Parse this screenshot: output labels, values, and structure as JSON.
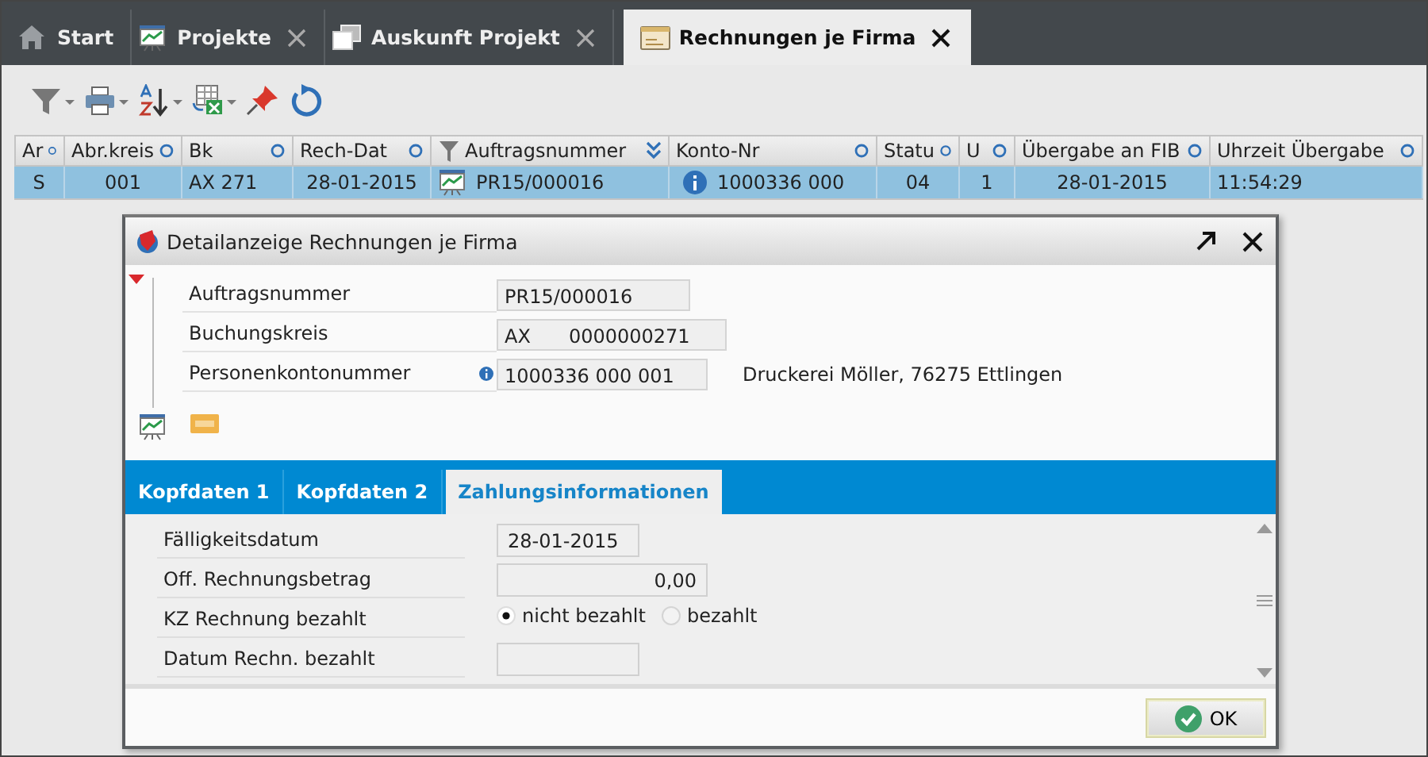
{
  "tabs": [
    {
      "label": "Start",
      "closable": false,
      "selected": false
    },
    {
      "label": "Projekte",
      "closable": true,
      "selected": false
    },
    {
      "label": "Auskunft Projekt",
      "closable": true,
      "selected": false
    },
    {
      "label": "Rechnungen je Firma",
      "closable": true,
      "selected": true
    }
  ],
  "table": {
    "columns": [
      {
        "label": "Ar",
        "filtered": false
      },
      {
        "label": "Abr.kreis",
        "filtered": false
      },
      {
        "label": "Bk",
        "filtered": false
      },
      {
        "label": "Rech-Dat",
        "filtered": false
      },
      {
        "label": "Auftragsnummer",
        "filtered": true
      },
      {
        "label": "Konto-Nr",
        "filtered": false
      },
      {
        "label": "Statu",
        "filtered": false
      },
      {
        "label": "U",
        "filtered": false
      },
      {
        "label": "Übergabe an FIB",
        "filtered": false
      },
      {
        "label": "Uhrzeit Übergabe",
        "filtered": false
      }
    ],
    "rows": [
      {
        "selected": true,
        "cells": [
          "S",
          "001",
          "AX 271",
          "28-01-2015",
          "PR15/000016",
          "1000336 000",
          "04",
          "1",
          "28-01-2015",
          "11:54:29"
        ]
      }
    ]
  },
  "dialog": {
    "title": "Detailanzeige Rechnungen je Firma",
    "fields": [
      {
        "label": "Auftragsnummer",
        "info": false,
        "values": [
          "PR15/000016"
        ]
      },
      {
        "label": "Buchungskreis",
        "info": false,
        "values": [
          "AX",
          "0000000271"
        ]
      },
      {
        "label": "Personenkontonummer",
        "info": true,
        "values": [
          "1000336 000 001"
        ],
        "note": "Druckerei Möller, 76275 Ettlingen"
      }
    ],
    "subtabs": [
      {
        "label": "Kopfdaten 1",
        "selected": false
      },
      {
        "label": "Kopfdaten 2",
        "selected": false
      },
      {
        "label": "Zahlungsinformationen",
        "selected": true
      }
    ],
    "payment_fields": [
      {
        "kind": "date",
        "label": "Fälligkeitsdatum",
        "value": "28-01-2015"
      },
      {
        "kind": "amount",
        "label": "Off. Rechnungsbetrag",
        "value": "0,00"
      },
      {
        "kind": "radio",
        "label": "KZ Rechnung bezahlt",
        "options": [
          {
            "label": "nicht bezahlt",
            "selected": true
          },
          {
            "label": "bezahlt",
            "selected": false
          }
        ]
      },
      {
        "kind": "date",
        "label": "Datum Rechn. bezahlt"
      }
    ],
    "ok_button": "OK"
  }
}
